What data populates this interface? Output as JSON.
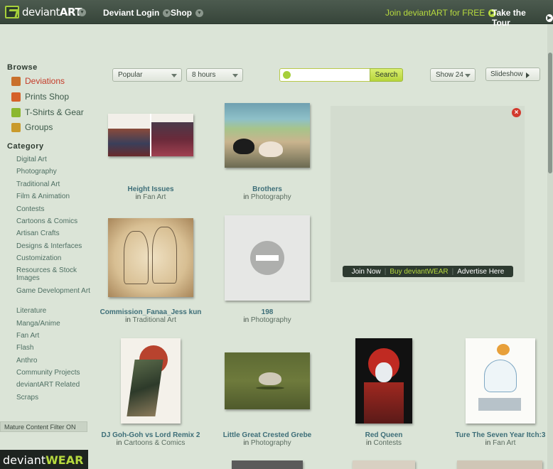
{
  "header": {
    "logo_text_light": "deviant",
    "logo_text_bold": "ART",
    "nav": [
      "Deviant Login",
      "Shop"
    ],
    "join": "Join deviantART for FREE",
    "tour": "Take the Tour"
  },
  "sidebar": {
    "browse_heading": "Browse",
    "browse_items": [
      {
        "label": "Deviations",
        "icon": "deviations-icon",
        "color": "#c9702c"
      },
      {
        "label": "Prints Shop",
        "icon": "prints-icon",
        "color": "#d5612a"
      },
      {
        "label": "T-Shirts & Gear",
        "icon": "tshirt-icon",
        "color": "#8bb82f"
      },
      {
        "label": "Groups",
        "icon": "house-icon",
        "color": "#c99a2c"
      }
    ],
    "category_heading": "Category",
    "categories": [
      "Digital Art",
      "Photography",
      "Traditional Art",
      "Film & Animation",
      "Contests",
      "Cartoons & Comics",
      "Artisan Crafts",
      "Designs & Interfaces",
      "Customization",
      "Resources & Stock Images",
      "Game Development Art",
      "Literature",
      "Manga/Anime",
      "Fan Art",
      "Flash",
      "Anthro",
      "Community Projects",
      "deviantART Related",
      "Scraps"
    ],
    "mature_filter": "Mature Content Filter ON",
    "deviantwear_light": "deviant",
    "deviantwear_bold": "WEAR"
  },
  "toolbar": {
    "sort": "Popular",
    "time": "8 hours",
    "search_value": "",
    "search_button": "Search",
    "show": "Show 24",
    "slideshow": "Slideshow"
  },
  "ad": {
    "join_now": "Join Now",
    "buy": "Buy deviantWEAR",
    "advertise": "Advertise Here"
  },
  "deviations": [
    {
      "title": "Height Issues",
      "category": "Fan Art"
    },
    {
      "title": "Brothers",
      "category": "Photography"
    },
    {
      "title": "Commission_Fanaa_Jess kun",
      "category": "Traditional Art"
    },
    {
      "title": "198",
      "category": "Photography"
    },
    {
      "title": "DJ Goh-Goh vs Lord Remix 2",
      "category": "Cartoons & Comics"
    },
    {
      "title": "Little Great Crested Grebe",
      "category": "Photography"
    },
    {
      "title": "Red Queen",
      "category": "Contests"
    },
    {
      "title": "Ture The Seven Year Itch:3",
      "category": "Fan Art"
    }
  ],
  "in_word": "in"
}
